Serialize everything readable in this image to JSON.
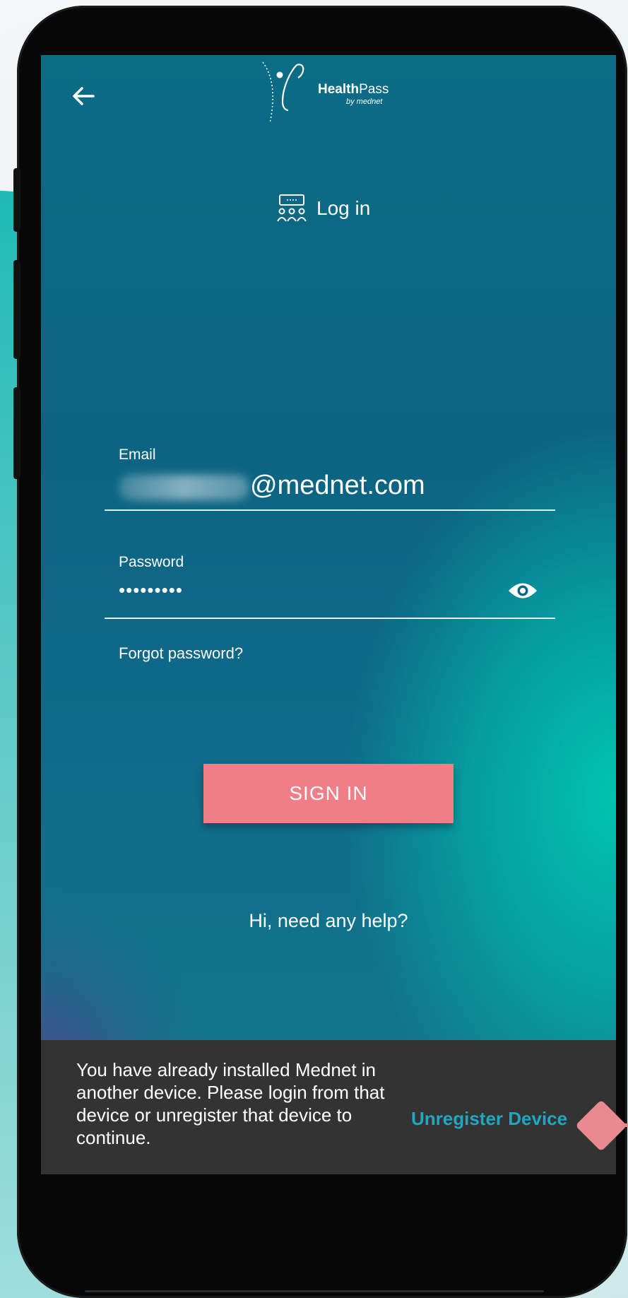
{
  "header": {
    "logo_bold": "Health",
    "logo_regular": "Pass",
    "logo_sub": "by mednet"
  },
  "login": {
    "title": "Log in"
  },
  "form": {
    "email_label": "Email",
    "email_value": "@mednet.com",
    "password_label": "Password",
    "password_value": "•••••••••",
    "forgot_label": "Forgot password?",
    "signin_label": "SIGN IN"
  },
  "help": {
    "label": "Hi, need any help?"
  },
  "snackbar": {
    "message": "You have already installed Mednet in another device. Please login from that device or unregister that device to continue.",
    "action": "Unregister Device"
  },
  "colors": {
    "signin_button": "#ef7e87",
    "snackbar_bg": "#333333",
    "snackbar_action": "#1fa7c0",
    "pointer": "#e98a8f"
  },
  "icons": {
    "back": "arrow-left-icon",
    "visibility": "eye-icon",
    "login": "group-screen-icon"
  }
}
